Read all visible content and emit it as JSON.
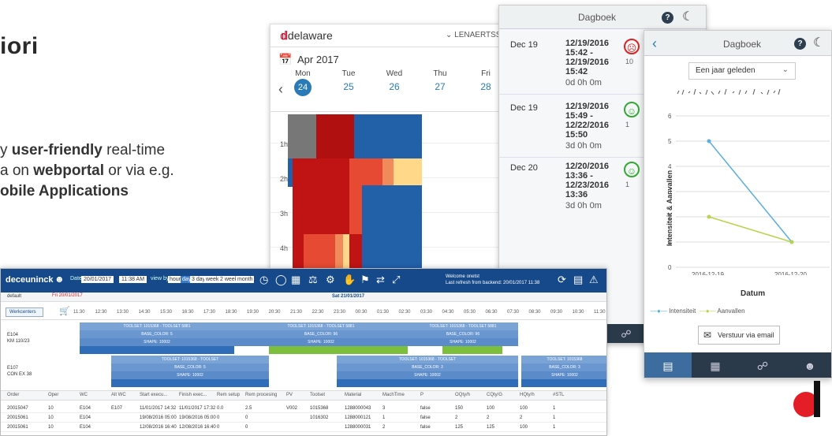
{
  "slide": {
    "title": "iori",
    "body_line1_pre": "y ",
    "body_line1_bold": "user-friendly",
    "body_line1_post": " real-time",
    "body_line2_pre": "a on ",
    "body_line2_bold": "webportal",
    "body_line2_post": " or via e.g.",
    "body_line3_bold": "obile Applications"
  },
  "delaware_app": {
    "logo": "delaware",
    "user": "LENAERTSS",
    "month": "Apr 2017",
    "days": [
      "Mon",
      "Tue",
      "Wed",
      "Thu",
      "Fri"
    ],
    "dates": [
      "24",
      "25",
      "26",
      "27",
      "28"
    ],
    "hours": [
      "1h",
      "2h",
      "3h",
      "4h"
    ]
  },
  "dagboek_list": {
    "title": "Dagboek",
    "entries": [
      {
        "date": "Dec 19",
        "range": [
          "12/19/2016",
          "15:42 -",
          "12/19/2016",
          "15:42"
        ],
        "duration": "0d 0h 0m",
        "count": "10",
        "mood": "sad"
      },
      {
        "date": "Dec 19",
        "range": [
          "12/19/2016",
          "15:49 -",
          "12/22/2016",
          "15:50"
        ],
        "duration": "3d 0h 0m",
        "count": "1",
        "mood": "happy"
      },
      {
        "date": "Dec 20",
        "range": [
          "12/20/2016",
          "13:36 -",
          "12/23/2016",
          "13:36"
        ],
        "duration": "3d 0h 0m",
        "count": "1",
        "mood": "happy"
      }
    ]
  },
  "dagboek_chart": {
    "title": "Dagboek",
    "period": "Een jaar geleden",
    "yticks": [
      "0",
      "1",
      "2",
      "3",
      "4",
      "5",
      "6"
    ],
    "xticks": [
      "2016-12-19",
      "2016-12-20"
    ],
    "ylabel": "Intensiteit & Aanvallen",
    "xlabel": "Datum",
    "legend_1": "Intensiteit",
    "legend_2": "Aanvallen",
    "email_button": "Verstuur via email",
    "colors": {
      "intensiteit": "#5aaee0",
      "aanvallen": "#b8d44a"
    },
    "chart_data": {
      "type": "line",
      "x": [
        "2016-12-19",
        "2016-12-20"
      ],
      "series": [
        {
          "name": "Intensiteit",
          "values": [
            5,
            1
          ]
        },
        {
          "name": "Aanvallen",
          "values": [
            2,
            1
          ]
        }
      ],
      "ylim": [
        0,
        6
      ],
      "xlabel": "Datum",
      "ylabel": "Intensiteit & Aanvallen"
    }
  },
  "deceuninck": {
    "logo": "deceuninck",
    "date_label": "Date",
    "date_value": "20/01/2017",
    "time_value": "11:38 AM",
    "view_by": "view by",
    "views": [
      "hour",
      "day",
      "3 days",
      "week",
      "2 weeks",
      "month"
    ],
    "welcome_1": "Welcome onetst",
    "welcome_2": "Last refresh from backend: 20/01/2017 11:38",
    "default": "default",
    "alert": "Fri 20/01/2017",
    "date_header": "Sat 21/01/2017",
    "button": "Werkcenters",
    "hours": [
      "11:30",
      "12:30",
      "13:30",
      "14:30",
      "15:30",
      "16:30",
      "17:30",
      "18:30",
      "19:30",
      "20:30",
      "21:30",
      "22:30",
      "23:30",
      "00:30",
      "01:30",
      "02:30",
      "03:30",
      "04:30",
      "05:30",
      "06:30",
      "07:30",
      "08:30",
      "09:30",
      "10:30",
      "11:30"
    ],
    "res1": [
      "E104",
      "KM 110/23"
    ],
    "res2": [
      "E107",
      "CON EX 38"
    ],
    "columns": [
      "Order",
      "Oper",
      "WC",
      "Alt WC",
      "Start execu...",
      "Finish exec...",
      "Rem setup",
      "Rem procesing",
      "PV",
      "Toolset",
      "Material",
      "MachTime",
      "P",
      "OQty/h",
      "CQty/G",
      "HQty/h",
      "#STL"
    ],
    "rows": [
      [
        "20015047",
        "10",
        "E104",
        "E107",
        "11/01/2017 14:32",
        "11/01/2017 17:32",
        "0.0",
        "2.5",
        "V002",
        "1015368",
        "1288000043",
        "3",
        "false",
        "150",
        "100",
        "100",
        "1"
      ],
      [
        "20015061",
        "10",
        "E104",
        "",
        "19/08/2016 05:00",
        "19/08/2016 05:00",
        "0",
        "0",
        "",
        "1016302",
        "1288000121",
        "1",
        "false",
        "2",
        "2",
        "2",
        "1"
      ],
      [
        "20015061",
        "10",
        "E104",
        "",
        "12/08/2016 16:40",
        "12/08/2016 16:40",
        "0",
        "0",
        "",
        "",
        "1288000031",
        "2",
        "false",
        "125",
        "125",
        "100",
        "1"
      ]
    ]
  }
}
